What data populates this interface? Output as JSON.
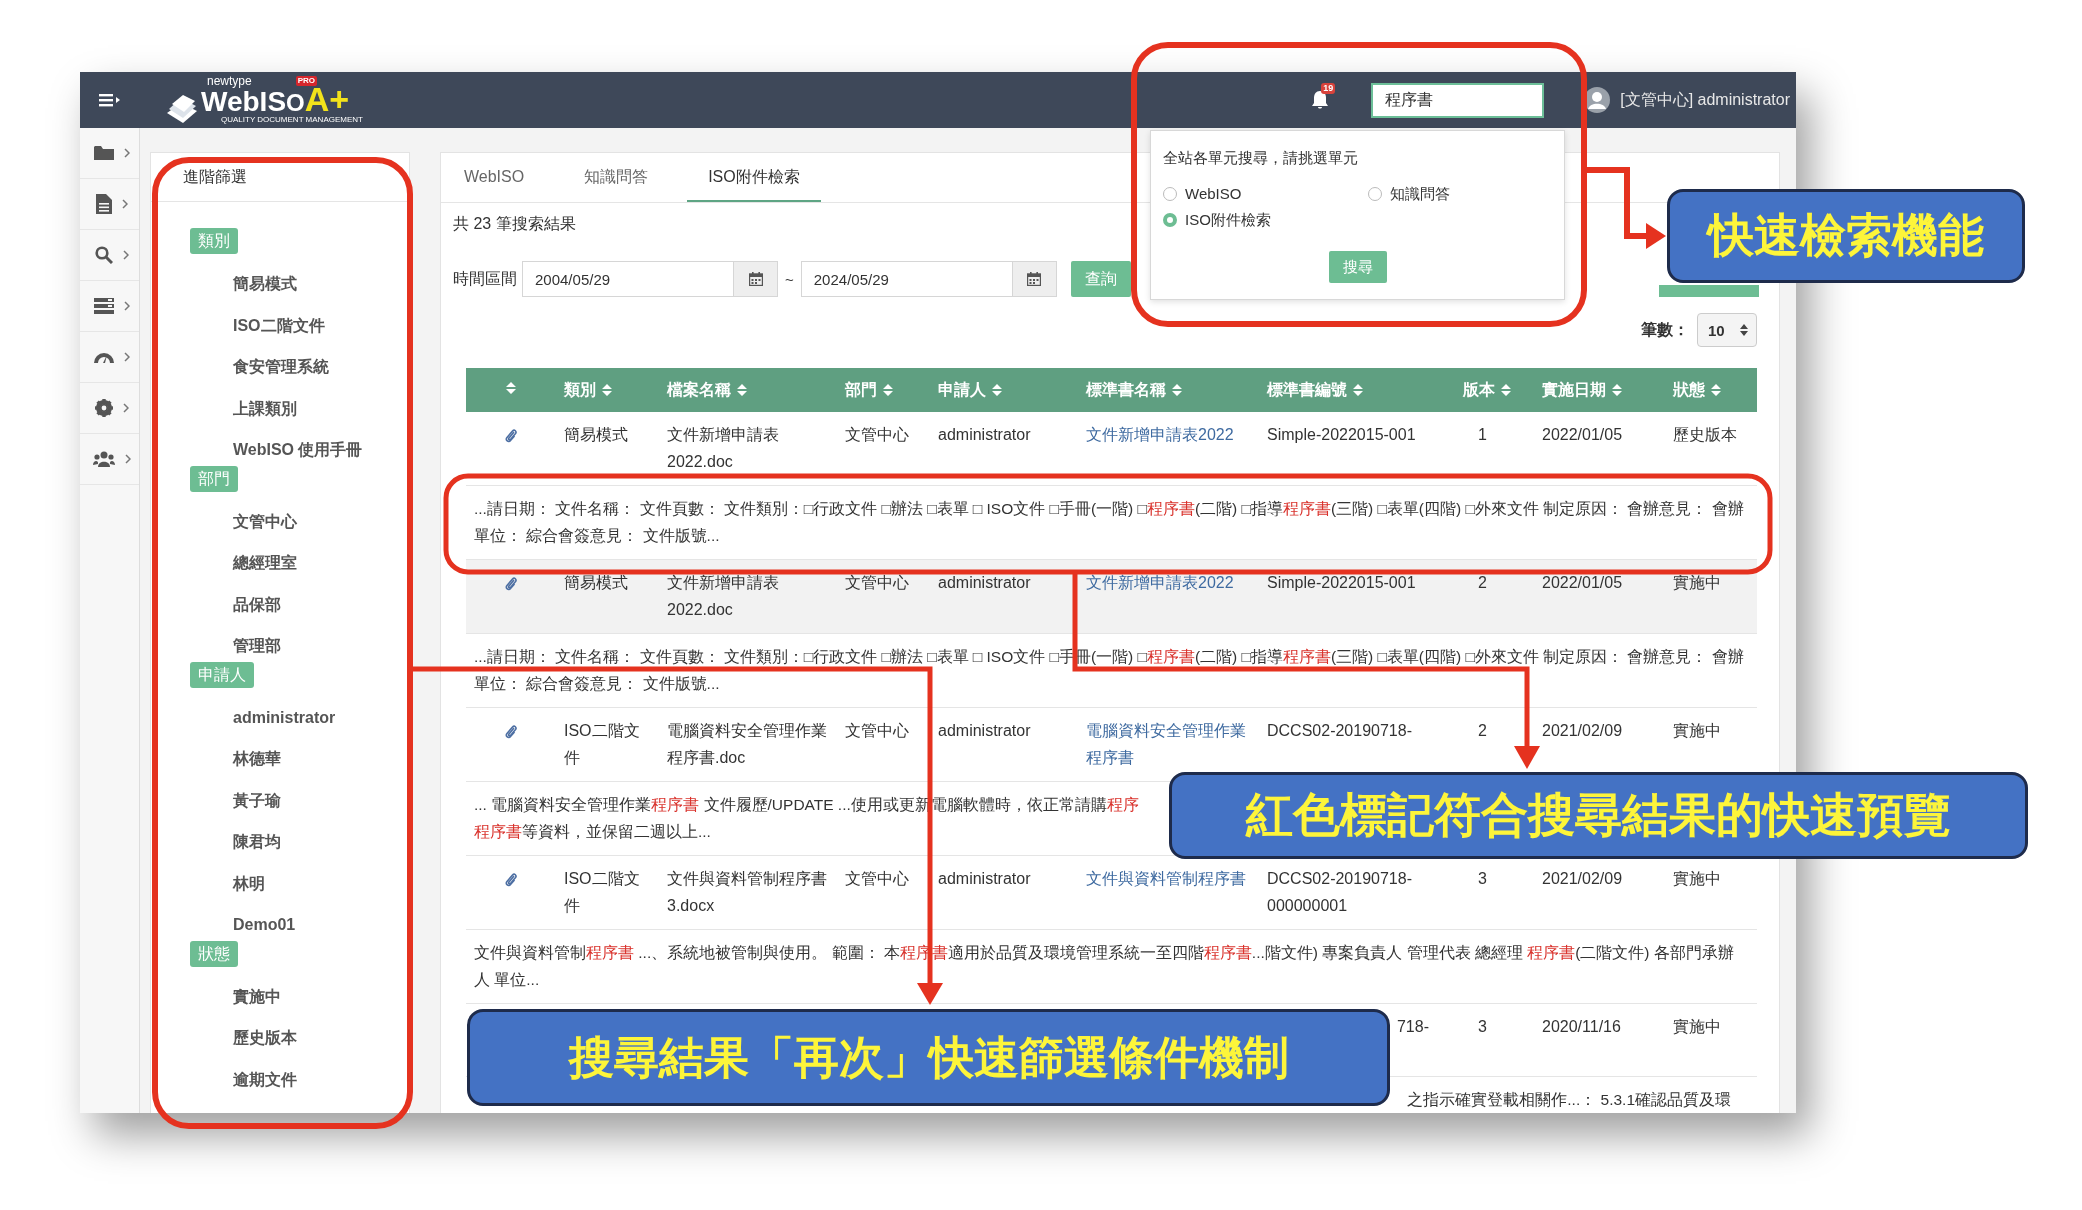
{
  "topbar": {
    "brand_small": "newtype",
    "brand": "WebIS",
    "brand_o": "O",
    "brand_mark": "A+",
    "brand_badge": "PRO",
    "brand_tagline": "QUALITY DOCUMENT MANAGEMENT",
    "notification_count": "19",
    "search_value": "程序書",
    "user": "[文管中心] administrator"
  },
  "filter": {
    "title": "進階篩選",
    "groups": [
      {
        "label": "類別",
        "items": [
          "簡易模式",
          "ISO二階文件",
          "食安管理系統",
          "上課類別",
          "WebISO 使用手冊"
        ]
      },
      {
        "label": "部門",
        "items": [
          "文管中心",
          "總經理室",
          "品保部",
          "管理部"
        ]
      },
      {
        "label": "申請人",
        "items": [
          "administrator",
          "林德華",
          "黃子瑜",
          "陳君均",
          "林明",
          "Demo01"
        ]
      },
      {
        "label": "狀態",
        "items": [
          "實施中",
          "歷史版本",
          "逾期文件"
        ]
      }
    ]
  },
  "tabs": [
    {
      "label": "WebISO",
      "selected": false
    },
    {
      "label": "知識問答",
      "selected": false
    },
    {
      "label": "ISO附件檢索",
      "selected": true
    }
  ],
  "result_count": "共 23 筆搜索結果",
  "date_range": {
    "label": "時間區間",
    "from": "2004/05/29",
    "separator": "~",
    "to": "2024/05/29"
  },
  "query_button": "查詢",
  "page_size": {
    "label": "筆數：",
    "value": "10"
  },
  "table": {
    "columns": [
      {
        "sortable": true
      },
      {
        "label": "類別",
        "sortable": true
      },
      {
        "label": "檔案名稱",
        "sortable": true
      },
      {
        "label": "部門",
        "sortable": true
      },
      {
        "label": "申請人",
        "sortable": true
      },
      {
        "label": "標準書名稱",
        "sortable": true
      },
      {
        "label": "標準書編號",
        "sortable": true
      },
      {
        "label": "版本",
        "sortable": true
      },
      {
        "label": "實施日期",
        "sortable": true
      },
      {
        "label": "狀態",
        "sortable": true
      }
    ],
    "rows": [
      {
        "highlighted": false,
        "attachment": true,
        "category": "簡易模式",
        "file": "文件新增申請表2022.doc",
        "dept": "文管中心",
        "applicant": "administrator",
        "standard_name": "文件新增申請表2022",
        "standard_no": "Simple-2022015-001",
        "version": "1",
        "date": "2022/01/05",
        "status": "歷史版本",
        "preview": {
          "kind": "full",
          "lines": [
            [
              {
                "text": "...請日期： 文件名稱： 文件頁數： 文件類別：□行政文件 □辦法 □表單 □ ISO文件 □手冊(一階) □",
                "match": false
              },
              {
                "text": "程序書",
                "match": true
              },
              {
                "text": "(二階) □指導",
                "match": false
              },
              {
                "text": "程序書",
                "match": true
              },
              {
                "text": "(三階) □表單(四階) □外來文件 制定原因： 會辦意見： 會辦單位： 綜合會簽意見： 文件版號...",
                "match": false
              }
            ]
          ]
        }
      },
      {
        "highlighted": true,
        "attachment": true,
        "category": "簡易模式",
        "file": "文件新增申請表2022.doc",
        "dept": "文管中心",
        "applicant": "administrator",
        "standard_name": "文件新增申請表2022",
        "standard_no": "Simple-2022015-001",
        "version": "2",
        "date": "2022/01/05",
        "status": "實施中",
        "preview": {
          "kind": "full",
          "lines": [
            [
              {
                "text": "...請日期： 文件名稱： 文件頁數： 文件類別：□行政文件 □辦法 □表單 □ ISO文件 □手冊(一階) □",
                "match": false
              },
              {
                "text": "程序書",
                "match": true
              },
              {
                "text": "(二階) □指導",
                "match": false
              },
              {
                "text": "程序書",
                "match": true
              },
              {
                "text": "(三階) □表單(四階) □外來文件 制定原因： 會辦意見： 會辦單位： 綜合會簽意見： 文件版號...",
                "match": false
              }
            ]
          ]
        }
      },
      {
        "highlighted": false,
        "attachment": true,
        "category": "ISO二階文件",
        "file": "電腦資料安全管理作業程序書.doc",
        "dept": "文管中心",
        "applicant": "administrator",
        "standard_name": "電腦資料安全管理作業程序書",
        "standard_no": "DCCS02-20190718-",
        "version": "2",
        "date": "2021/02/09",
        "status": "實施中",
        "preview": {
          "kind": "full",
          "lines": [
            [
              {
                "text": "... 電腦資料安全管理作業",
                "match": false
              },
              {
                "text": "程序書",
                "match": true
              },
              {
                "text": " 文件履歷/UPDATE ...使用或更新電腦軟體時，依正常請購",
                "match": false
              },
              {
                "text": "程序",
                "match": true
              }
            ],
            [
              {
                "text": "程序書",
                "match": true
              },
              {
                "text": "等資料，並保留二週以上...",
                "match": false
              }
            ]
          ]
        }
      },
      {
        "highlighted": false,
        "attachment": true,
        "category": "ISO二階文件",
        "file": "文件與資料管制程序書3.docx",
        "dept": "文管中心",
        "applicant": "administrator",
        "standard_name": "文件與資料管制程序書",
        "standard_no": "DCCS02-20190718-000000001",
        "version": "3",
        "date": "2021/02/09",
        "status": "實施中",
        "preview": {
          "kind": "full",
          "lines": [
            [
              {
                "text": "文件與資料管制",
                "match": false
              },
              {
                "text": "程序書",
                "match": true
              },
              {
                "text": " ...、系統地被管制與使用。 範圍： 本",
                "match": false
              },
              {
                "text": "程序書",
                "match": true
              },
              {
                "text": "適用於品質及環境管理系統一至四階",
                "match": false
              },
              {
                "text": "程序書",
                "match": true
              },
              {
                "text": "...階文件) 專案負責人 管理代表 總經理 ",
                "match": false
              },
              {
                "text": "程序書",
                "match": true
              },
              {
                "text": "(二階文件) 各部門承辦人 單位...",
                "match": false
              }
            ]
          ]
        }
      },
      {
        "highlighted": false,
        "attachment": false,
        "standard_no_tail": "718-",
        "version": "3",
        "date": "2020/11/16",
        "status": "實施中",
        "preview": {
          "kind": "tail",
          "lines": [
            [
              {
                "text": "之指示確實登載相關作...： 5.3.1確認品質及環",
                "match": false
              }
            ]
          ]
        }
      }
    ]
  },
  "search_popup": {
    "hint": "全站各單元搜尋，請挑選單元",
    "options": [
      {
        "label": "WebISO",
        "selected": false
      },
      {
        "label": "知識問答",
        "selected": false
      },
      {
        "label": "ISO附件檢索",
        "selected": true
      }
    ],
    "button": "搜尋"
  },
  "callouts": [
    {
      "text": "快速檢索機能"
    },
    {
      "text": "紅色標記符合搜尋結果的快速預覽"
    },
    {
      "text": "搜尋結果「再次」快速篩選條件機制"
    }
  ]
}
